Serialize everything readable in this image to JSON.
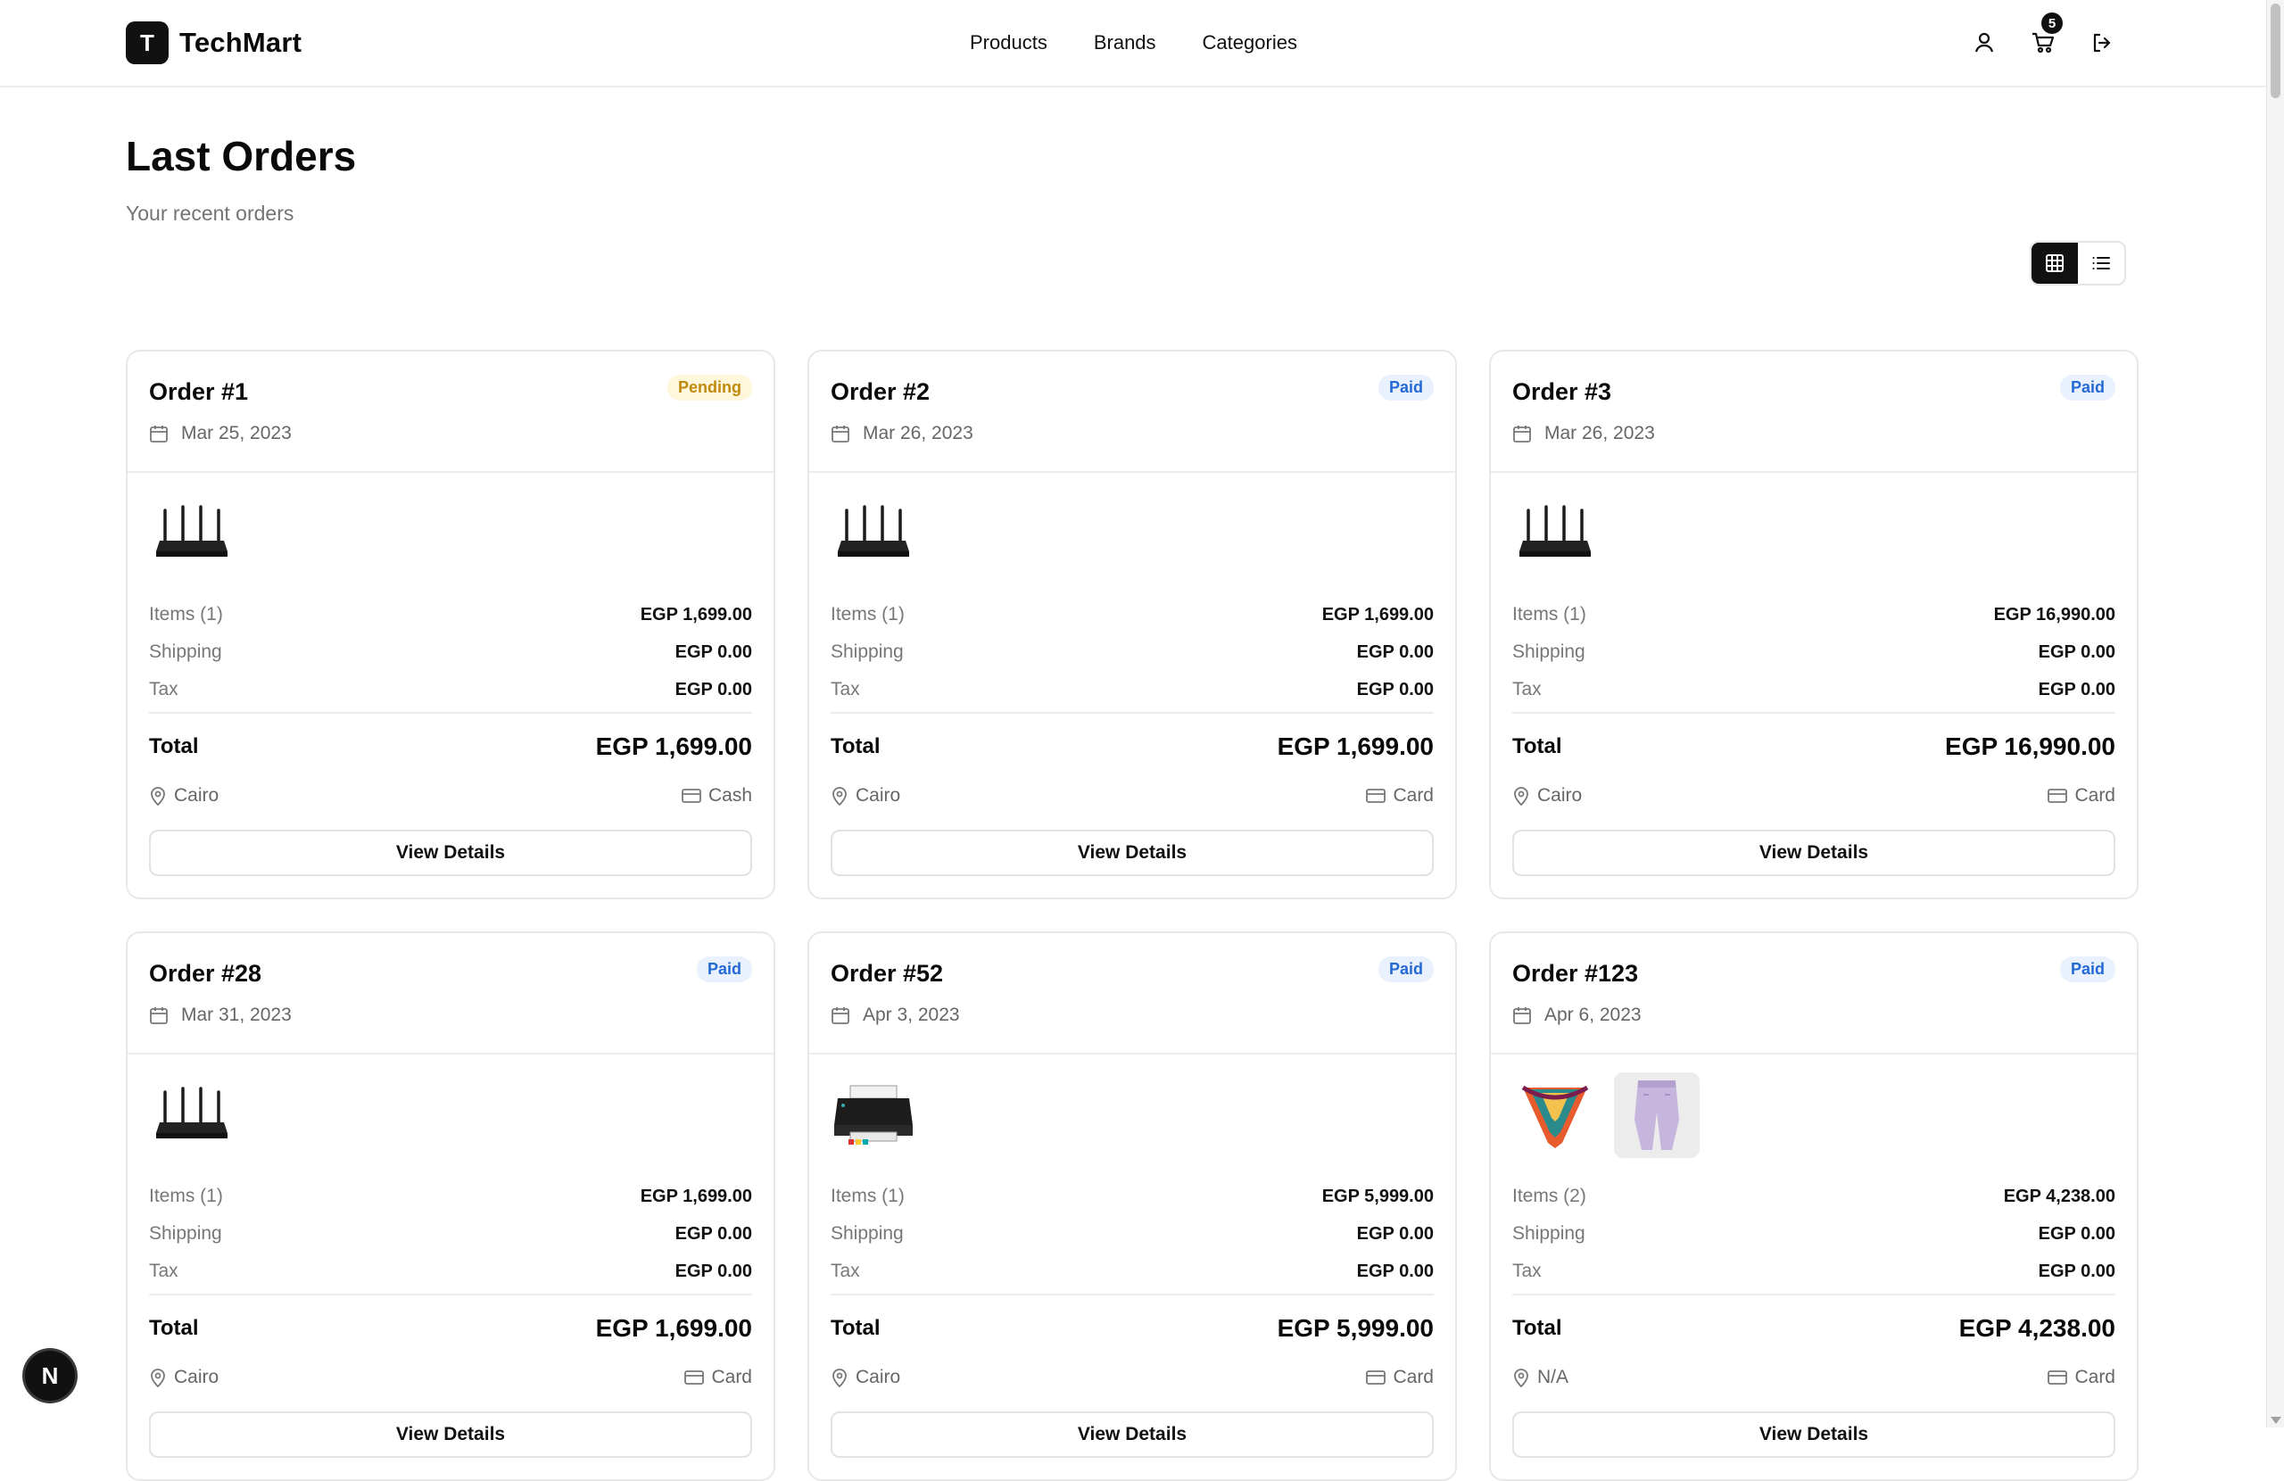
{
  "brand": {
    "logo_letter": "T",
    "name": "TechMart"
  },
  "nav": [
    "Products",
    "Brands",
    "Categories"
  ],
  "header_icons": {
    "user": "user-icon",
    "cart": "cart-icon",
    "logout": "logout-icon",
    "cart_count": "5"
  },
  "page": {
    "title": "Last Orders",
    "subtitle": "Your recent orders"
  },
  "view_toggle": {
    "active": "grid",
    "options": [
      "grid-view-icon",
      "list-view-icon"
    ]
  },
  "labels": {
    "shipping": "Shipping",
    "tax": "Tax",
    "total": "Total",
    "view_details": "View Details"
  },
  "colors": {
    "pending_bg": "#fef7dc",
    "pending_text": "#c08a0c",
    "paid_bg": "#e8f1fd",
    "paid_text": "#2469d4"
  },
  "orders": [
    {
      "title": "Order #1",
      "status": "Pending",
      "date": "Mar 25, 2023",
      "items_label": "Items (1)",
      "items": "EGP 1,699.00",
      "shipping": "EGP 0.00",
      "tax": "EGP 0.00",
      "total": "EGP 1,699.00",
      "city": "Cairo",
      "payment": "Cash",
      "images": [
        "router"
      ]
    },
    {
      "title": "Order #2",
      "status": "Paid",
      "date": "Mar 26, 2023",
      "items_label": "Items (1)",
      "items": "EGP 1,699.00",
      "shipping": "EGP 0.00",
      "tax": "EGP 0.00",
      "total": "EGP 1,699.00",
      "city": "Cairo",
      "payment": "Card",
      "images": [
        "router"
      ]
    },
    {
      "title": "Order #3",
      "status": "Paid",
      "date": "Mar 26, 2023",
      "items_label": "Items (1)",
      "items": "EGP 16,990.00",
      "shipping": "EGP 0.00",
      "tax": "EGP 0.00",
      "total": "EGP 16,990.00",
      "city": "Cairo",
      "payment": "Card",
      "images": [
        "router"
      ]
    },
    {
      "title": "Order #28",
      "status": "Paid",
      "date": "Mar 31, 2023",
      "items_label": "Items (1)",
      "items": "EGP 1,699.00",
      "shipping": "EGP 0.00",
      "tax": "EGP 0.00",
      "total": "EGP 1,699.00",
      "city": "Cairo",
      "payment": "Card",
      "images": [
        "router"
      ]
    },
    {
      "title": "Order #52",
      "status": "Paid",
      "date": "Apr 3, 2023",
      "items_label": "Items (1)",
      "items": "EGP 5,999.00",
      "shipping": "EGP 0.00",
      "tax": "EGP 0.00",
      "total": "EGP 5,999.00",
      "city": "Cairo",
      "payment": "Card",
      "images": [
        "printer"
      ]
    },
    {
      "title": "Order #123",
      "status": "Paid",
      "date": "Apr 6, 2023",
      "items_label": "Items (2)",
      "items": "EGP 4,238.00",
      "shipping": "EGP 0.00",
      "tax": "EGP 0.00",
      "total": "EGP 4,238.00",
      "city": "N/A",
      "payment": "Card",
      "images": [
        "scarf",
        "sweatpants"
      ]
    }
  ],
  "floating_badge": "N"
}
